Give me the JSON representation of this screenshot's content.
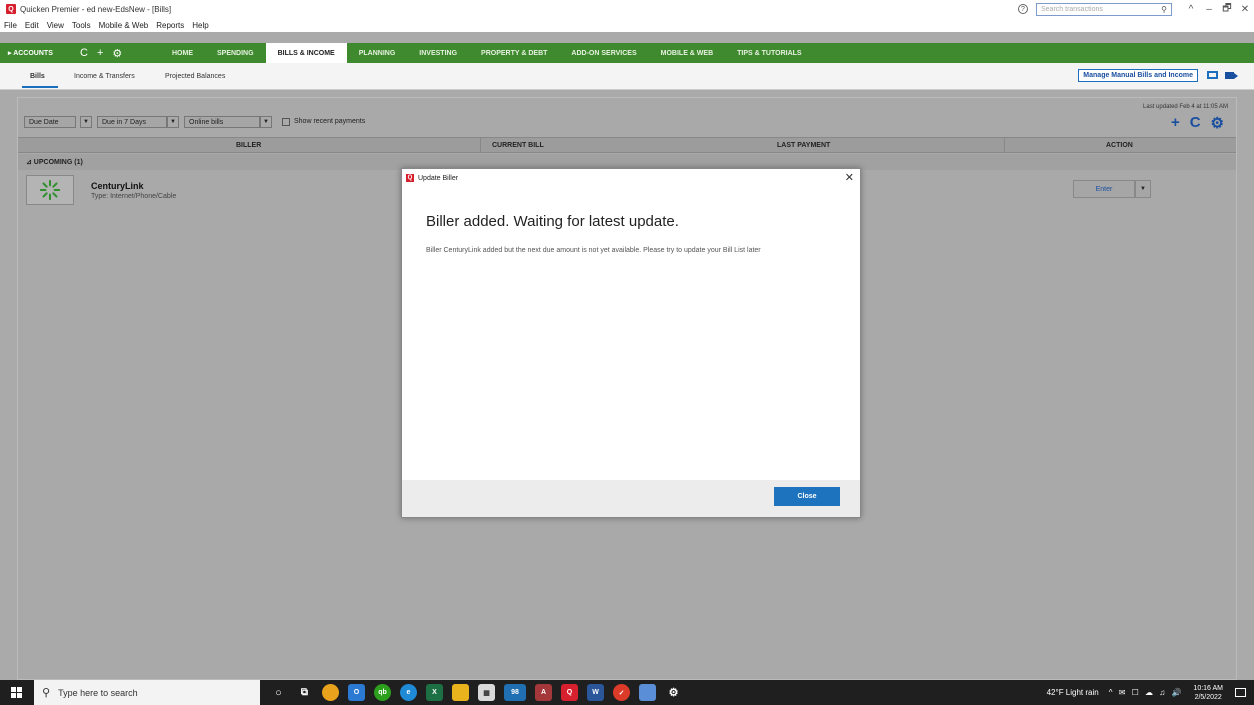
{
  "window": {
    "title": "Quicken Premier - ed new-EdsNew - [Bills]",
    "search_placeholder": "Search transactions",
    "controls": [
      "^",
      "–",
      "🗗",
      "✕"
    ]
  },
  "menu": [
    "File",
    "Edit",
    "View",
    "Tools",
    "Mobile & Web",
    "Reports",
    "Help"
  ],
  "nav": {
    "accounts": "▸ ACCOUNTS",
    "tools": [
      "C",
      "+",
      "⚙"
    ],
    "tabs": [
      {
        "label": "HOME"
      },
      {
        "label": "SPENDING"
      },
      {
        "label": "BILLS & INCOME",
        "active": true
      },
      {
        "label": "PLANNING"
      },
      {
        "label": "INVESTING"
      },
      {
        "label": "PROPERTY & DEBT"
      },
      {
        "label": "ADD-ON SERVICES"
      },
      {
        "label": "MOBILE & WEB"
      },
      {
        "label": "TIPS & TUTORIALS"
      }
    ]
  },
  "subtabs": {
    "bills": "Bills",
    "income_transfers": "Income & Transfers",
    "projected_balances": "Projected Balances",
    "manage_button": "Manage Manual Bills and Income"
  },
  "filters": {
    "sort": "Due Date",
    "range": "Due in 7 Days",
    "type": "Online bills",
    "show_recent": "Show recent payments",
    "last_updated": "Last updated Feb 4 at 11:05 AM"
  },
  "table": {
    "headers": [
      "BILLER",
      "CURRENT BILL",
      "LAST PAYMENT",
      "ACTION"
    ],
    "section": "⊿ UPCOMING (1)",
    "row": {
      "name": "CenturyLink",
      "type": "Type: Internet/Phone/Cable",
      "action": "Enter"
    }
  },
  "dialog": {
    "title": "Update Biller",
    "heading": "Biller added. Waiting for latest update.",
    "message": "Biller CenturyLink added but the next due amount is not yet available. Please try to update your Bill List later",
    "close_button": "Close"
  },
  "taskbar": {
    "search_placeholder": "Type here to search",
    "weather": "42°F  Light rain",
    "time": "10:16 AM",
    "date": "2/5/2022",
    "mail_badge": "98"
  },
  "colors": {
    "nav_green": "#3f8a2e",
    "accent_blue": "#1e73be",
    "quicken_red": "#d6202d"
  }
}
